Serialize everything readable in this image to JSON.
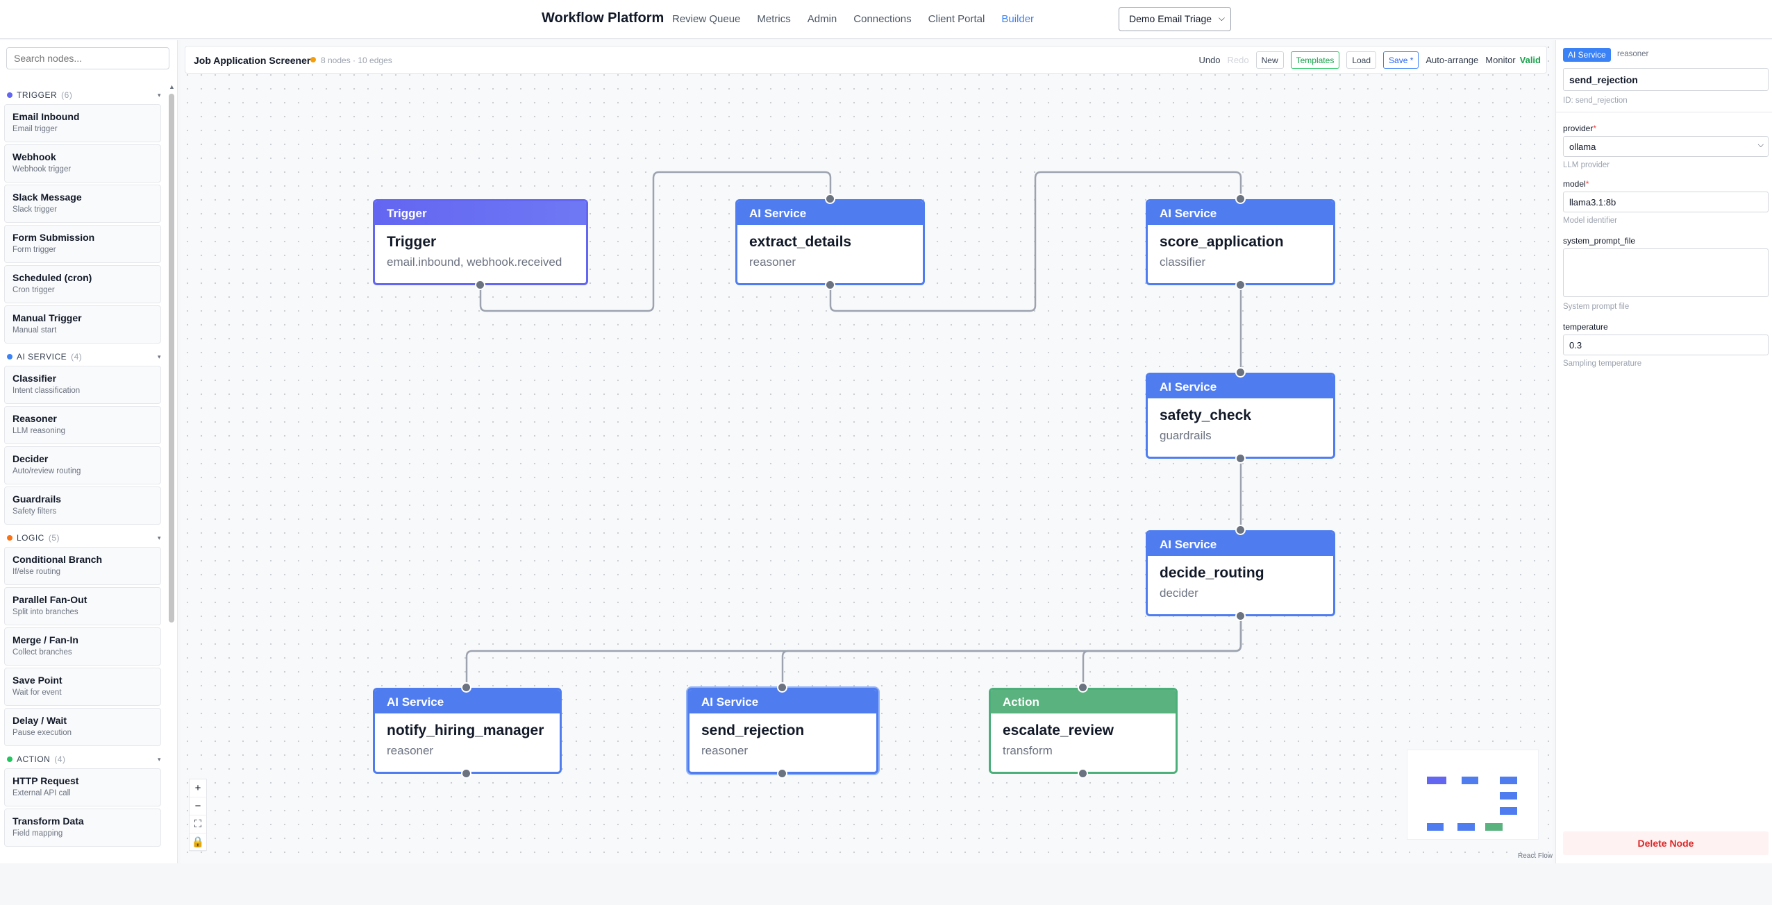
{
  "nav": {
    "brand": "Workflow Platform",
    "links": [
      "Review Queue",
      "Metrics",
      "Admin",
      "Connections",
      "Client Portal",
      "Builder"
    ],
    "active": "Builder",
    "workflow_select": "Demo Email Triage"
  },
  "palette": {
    "search_placeholder": "Search nodes...",
    "categories": [
      {
        "name": "TRIGGER",
        "count": "(6)",
        "color": "#6366f1",
        "items": [
          {
            "title": "Email Inbound",
            "subtitle": "Email trigger"
          },
          {
            "title": "Webhook",
            "subtitle": "Webhook trigger"
          },
          {
            "title": "Slack Message",
            "subtitle": "Slack trigger"
          },
          {
            "title": "Form Submission",
            "subtitle": "Form trigger"
          },
          {
            "title": "Scheduled (cron)",
            "subtitle": "Cron trigger"
          },
          {
            "title": "Manual Trigger",
            "subtitle": "Manual start"
          }
        ]
      },
      {
        "name": "AI SERVICE",
        "count": "(4)",
        "color": "#3b82f6",
        "items": [
          {
            "title": "Classifier",
            "subtitle": "Intent classification"
          },
          {
            "title": "Reasoner",
            "subtitle": "LLM reasoning"
          },
          {
            "title": "Decider",
            "subtitle": "Auto/review routing"
          },
          {
            "title": "Guardrails",
            "subtitle": "Safety filters"
          }
        ]
      },
      {
        "name": "LOGIC",
        "count": "(5)",
        "color": "#f97316",
        "items": [
          {
            "title": "Conditional Branch",
            "subtitle": "If/else routing"
          },
          {
            "title": "Parallel Fan-Out",
            "subtitle": "Split into branches"
          },
          {
            "title": "Merge / Fan-In",
            "subtitle": "Collect branches"
          },
          {
            "title": "Save Point",
            "subtitle": "Wait for event"
          },
          {
            "title": "Delay / Wait",
            "subtitle": "Pause execution"
          }
        ]
      },
      {
        "name": "ACTION",
        "count": "(4)",
        "color": "#22c55e",
        "items": [
          {
            "title": "HTTP Request",
            "subtitle": "External API call"
          },
          {
            "title": "Transform Data",
            "subtitle": "Field mapping"
          }
        ]
      }
    ]
  },
  "toolbar": {
    "workflow_name": "Job Application Screener",
    "stats": "8 nodes · 10 edges",
    "undo": "Undo",
    "redo": "Redo",
    "new": "New",
    "templates": "Templates",
    "load": "Load",
    "save": "Save *",
    "auto_arrange": "Auto-arrange",
    "monitor": "Monitor",
    "valid": "Valid"
  },
  "nodes": {
    "trigger": {
      "type": "Trigger",
      "name": "Trigger",
      "sub": "email.inbound, webhook.received"
    },
    "extract": {
      "type": "AI Service",
      "name": "extract_details",
      "sub": "reasoner"
    },
    "score": {
      "type": "AI Service",
      "name": "score_application",
      "sub": "classifier"
    },
    "safety": {
      "type": "AI Service",
      "name": "safety_check",
      "sub": "guardrails"
    },
    "decide": {
      "type": "AI Service",
      "name": "decide_routing",
      "sub": "decider"
    },
    "notify": {
      "type": "AI Service",
      "name": "notify_hiring_manager",
      "sub": "reasoner"
    },
    "reject": {
      "type": "AI Service",
      "name": "send_rejection",
      "sub": "reasoner"
    },
    "escalate": {
      "type": "Action",
      "name": "escalate_review",
      "sub": "transform"
    }
  },
  "canvas": {
    "zoom_in": "+",
    "zoom_out": "−",
    "fit": "⛶",
    "lock": "🔒",
    "attribution": "React Flow"
  },
  "props": {
    "type_badge": "AI Service",
    "sub_badge": "reasoner",
    "name": "send_rejection",
    "id_label": "ID: send_rejection",
    "fields": {
      "provider": {
        "label": "provider",
        "value": "ollama",
        "help": "LLM provider"
      },
      "model": {
        "label": "model",
        "value": "llama3.1:8b",
        "help": "Model identifier"
      },
      "system_prompt_file": {
        "label": "system_prompt_file",
        "value": "",
        "help": "System prompt file"
      },
      "temperature": {
        "label": "temperature",
        "value": "0.3",
        "help": "Sampling temperature"
      }
    },
    "delete": "Delete Node"
  }
}
